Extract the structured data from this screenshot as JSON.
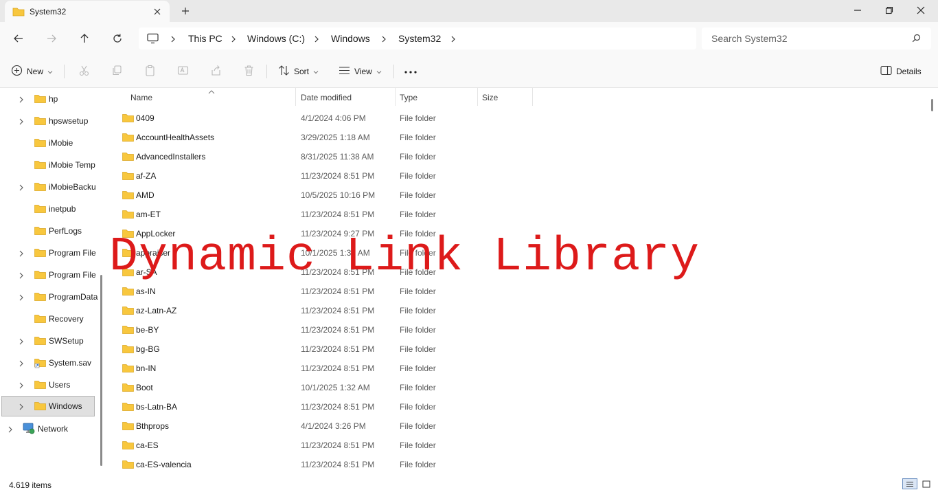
{
  "window": {
    "tab_title": "System32",
    "tab_icon": "folder-icon"
  },
  "address": {
    "crumbs": [
      "This PC",
      "Windows (C:)",
      "Windows",
      "System32"
    ],
    "search_placeholder": "Search System32"
  },
  "toolbar": {
    "new_label": "New",
    "sort_label": "Sort",
    "view_label": "View",
    "more_label": "···",
    "details_label": "Details"
  },
  "sidebar": {
    "items": [
      {
        "label": "hp",
        "expandable": true
      },
      {
        "label": "hpswsetup",
        "expandable": true
      },
      {
        "label": "iMobie",
        "expandable": false
      },
      {
        "label": "iMobie Temp",
        "expandable": false
      },
      {
        "label": "iMobieBacku",
        "expandable": true
      },
      {
        "label": "inetpub",
        "expandable": false
      },
      {
        "label": "PerfLogs",
        "expandable": false
      },
      {
        "label": "Program File",
        "expandable": true
      },
      {
        "label": "Program File",
        "expandable": true
      },
      {
        "label": "ProgramData",
        "expandable": true
      },
      {
        "label": "Recovery",
        "expandable": false
      },
      {
        "label": "SWSetup",
        "expandable": true
      },
      {
        "label": "System.sav",
        "expandable": true
      },
      {
        "label": "Users",
        "expandable": true
      },
      {
        "label": "Windows",
        "expandable": true,
        "selected": true
      },
      {
        "label": "Network",
        "expandable": true
      }
    ]
  },
  "columns": {
    "name": "Name",
    "date": "Date modified",
    "type": "Type",
    "size": "Size"
  },
  "files": [
    {
      "name": "0409",
      "date": "4/1/2024 4:06 PM",
      "type": "File folder"
    },
    {
      "name": "AccountHealthAssets",
      "date": "3/29/2025 1:18 AM",
      "type": "File folder"
    },
    {
      "name": "AdvancedInstallers",
      "date": "8/31/2025 11:38 AM",
      "type": "File folder"
    },
    {
      "name": "af-ZA",
      "date": "11/23/2024 8:51 PM",
      "type": "File folder"
    },
    {
      "name": "AMD",
      "date": "10/5/2025 10:16 PM",
      "type": "File folder"
    },
    {
      "name": "am-ET",
      "date": "11/23/2024 8:51 PM",
      "type": "File folder"
    },
    {
      "name": "AppLocker",
      "date": "11/23/2024 9:27 PM",
      "type": "File folder"
    },
    {
      "name": "appraiser",
      "date": "10/1/2025 1:32 AM",
      "type": "File folder"
    },
    {
      "name": "ar-SA",
      "date": "11/23/2024 8:51 PM",
      "type": "File folder"
    },
    {
      "name": "as-IN",
      "date": "11/23/2024 8:51 PM",
      "type": "File folder"
    },
    {
      "name": "az-Latn-AZ",
      "date": "11/23/2024 8:51 PM",
      "type": "File folder"
    },
    {
      "name": "be-BY",
      "date": "11/23/2024 8:51 PM",
      "type": "File folder"
    },
    {
      "name": "bg-BG",
      "date": "11/23/2024 8:51 PM",
      "type": "File folder"
    },
    {
      "name": "bn-IN",
      "date": "11/23/2024 8:51 PM",
      "type": "File folder"
    },
    {
      "name": "Boot",
      "date": "10/1/2025 1:32 AM",
      "type": "File folder"
    },
    {
      "name": "bs-Latn-BA",
      "date": "11/23/2024 8:51 PM",
      "type": "File folder"
    },
    {
      "name": "Bthprops",
      "date": "4/1/2024 3:26 PM",
      "type": "File folder"
    },
    {
      "name": "ca-ES",
      "date": "11/23/2024 8:51 PM",
      "type": "File folder"
    },
    {
      "name": "ca-ES-valencia",
      "date": "11/23/2024 8:51 PM",
      "type": "File folder"
    }
  ],
  "overlay_text": "Dynamic Link Library",
  "status": {
    "item_count": "4.619 items"
  },
  "colors": {
    "folder_yellow": "#f8c73e",
    "overlay_red": "#dd1a1a",
    "selection_gray": "#e0e0e0"
  }
}
